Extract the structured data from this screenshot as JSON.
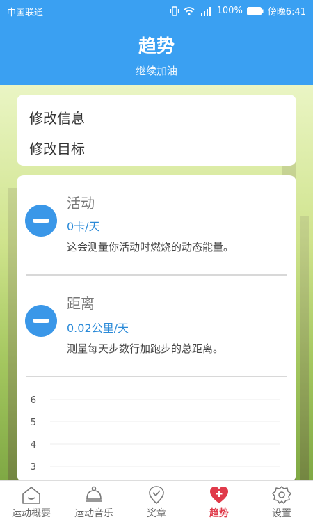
{
  "status_bar": {
    "carrier": "中国联通",
    "battery": "100%",
    "time": "傍晚6:41"
  },
  "header": {
    "title": "趋势",
    "subtitle": "继续加油"
  },
  "edit_card": {
    "items": [
      "修改信息",
      "修改目标"
    ]
  },
  "metrics": [
    {
      "name": "活动",
      "value": "0卡/天",
      "description": "这会测量你活动时燃烧的动态能量。"
    },
    {
      "name": "距离",
      "value": "0.02公里/天",
      "description": "测量每天步数行加跑步的总距离。"
    }
  ],
  "chart_data": {
    "type": "line",
    "y_tick_labels": [
      "6",
      "5",
      "4",
      "3"
    ],
    "grid": true
  },
  "nav": {
    "items": [
      {
        "label": "运动概要",
        "icon": "home-icon"
      },
      {
        "label": "运动音乐",
        "icon": "bell-icon"
      },
      {
        "label": "奖章",
        "icon": "medal-icon"
      },
      {
        "label": "趋势",
        "icon": "heart-plus-icon",
        "active": true
      },
      {
        "label": "设置",
        "icon": "gear-icon"
      }
    ],
    "active_color": "#e03a4a"
  },
  "colors": {
    "primary": "#3aa0f2",
    "accent_value": "#2a8ad8"
  }
}
